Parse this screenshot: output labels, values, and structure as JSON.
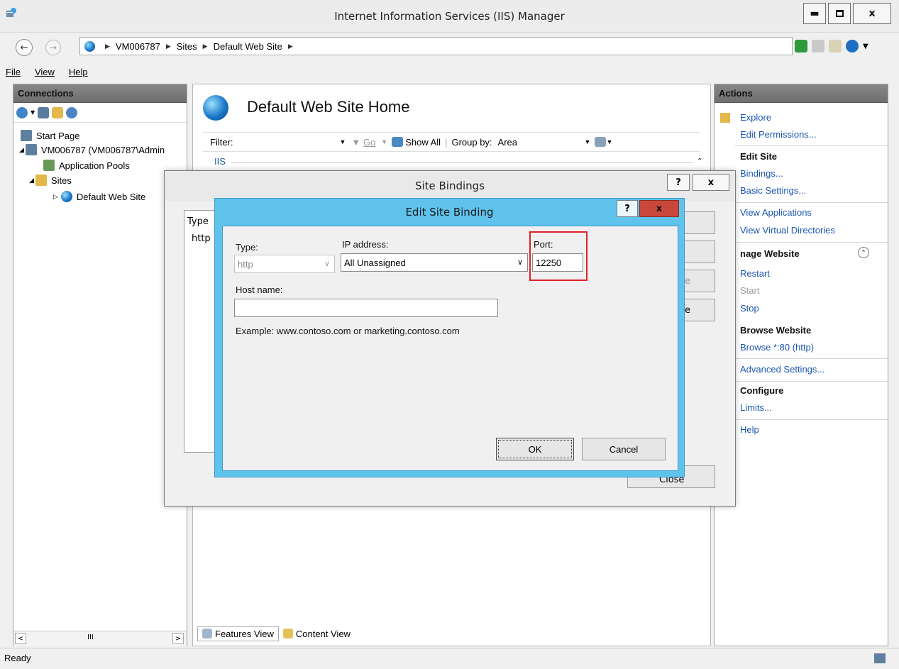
{
  "window": {
    "title": "Internet Information Services (IIS) Manager",
    "min": "▁",
    "max": "□",
    "close": "x"
  },
  "address": {
    "items": [
      "VM006787",
      "Sites",
      "Default Web Site"
    ],
    "sep": "▶"
  },
  "menu": {
    "file": "File",
    "view": "View",
    "help": "Help"
  },
  "connections": {
    "title": "Connections",
    "tree": [
      {
        "label": "Start Page"
      },
      {
        "label": "VM006787 (VM006787\\Admin"
      },
      {
        "label": "Application Pools"
      },
      {
        "label": "Sites"
      },
      {
        "label": "Default Web Site"
      }
    ],
    "scroll_mid": "III"
  },
  "center": {
    "title": "Default Web Site Home",
    "filter_label": "Filter:",
    "go_label": "Go",
    "show_all": "Show All",
    "group_by": "Group by:",
    "group_value": "Area",
    "section": "IIS",
    "features_view": "Features View",
    "content_view": "Content View"
  },
  "actions": {
    "title": "Actions",
    "explore": "Explore",
    "edit_permissions": "Edit Permissions...",
    "edit_site": "Edit Site",
    "bindings": "Bindings...",
    "basic_settings": "Basic Settings...",
    "view_applications": "View Applications",
    "view_virtual_dirs": "View Virtual Directories",
    "manage_website": "nage Website",
    "restart": "Restart",
    "start": "Start",
    "stop": "Stop",
    "browse_website": "Browse Website",
    "browse_80": "Browse *:80 (http)",
    "advanced_settings": "Advanced Settings...",
    "configure": "Configure",
    "limits": "Limits...",
    "help": "Help"
  },
  "status": {
    "text": "Ready"
  },
  "site_bindings": {
    "title": "Site Bindings",
    "help": "?",
    "close": "x",
    "col_type": "Type",
    "row_type": "http",
    "side_partial_1": "e",
    "side_partial_2": "e",
    "close_partial": "Close"
  },
  "edit_binding": {
    "title": "Edit Site Binding",
    "help": "?",
    "close": "x",
    "type_label": "Type:",
    "type_value": "http",
    "ip_label": "IP address:",
    "ip_value": "All Unassigned",
    "port_label": "Port:",
    "port_value": "12250",
    "host_label": "Host name:",
    "host_value": "",
    "example": "Example: www.contoso.com or marketing.contoso.com",
    "ok": "OK",
    "cancel": "Cancel"
  },
  "colors": {
    "accent": "#5fc3ec",
    "highlight": "#e0202a",
    "link": "#1c56b0"
  }
}
